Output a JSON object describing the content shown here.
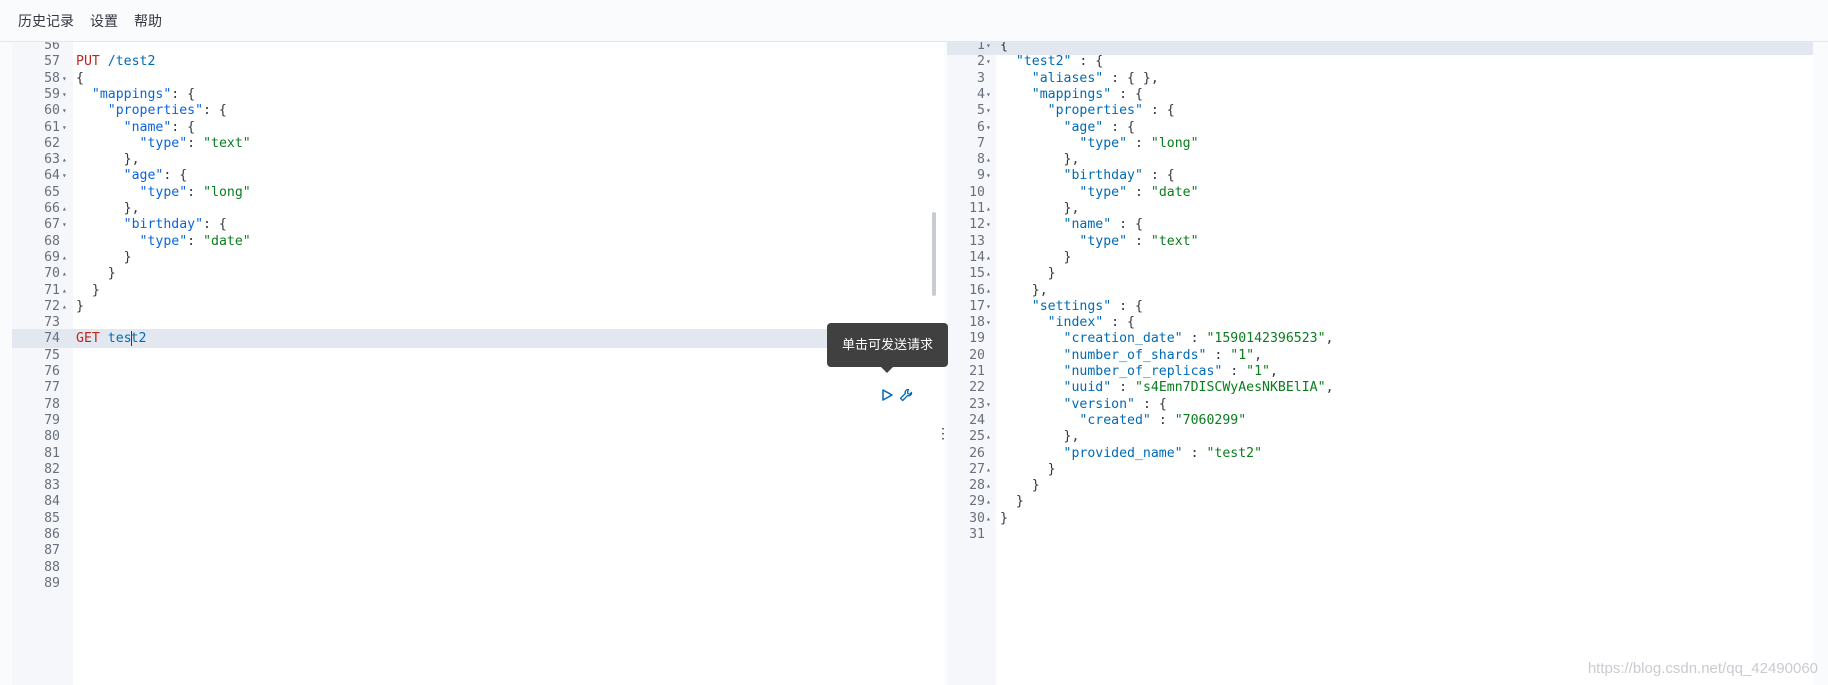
{
  "menu": [
    "历史记录",
    "设置",
    "帮助"
  ],
  "tooltip": "单击可发送请求",
  "watermark": "https://blog.csdn.net/qq_42490060",
  "left_editor": {
    "lines": [
      {
        "n": "56",
        "fold": "",
        "tokens": []
      },
      {
        "n": "57",
        "fold": "",
        "tokens": [
          [
            "PUT",
            "method"
          ],
          [
            " /test2",
            "url"
          ]
        ]
      },
      {
        "n": "58",
        "fold": "▾",
        "tokens": [
          [
            "{",
            "punc"
          ]
        ]
      },
      {
        "n": "59",
        "fold": "▾",
        "tokens": [
          [
            "  ",
            "punc"
          ],
          [
            "\"mappings\"",
            "key"
          ],
          [
            ": {",
            "punc"
          ]
        ]
      },
      {
        "n": "60",
        "fold": "▾",
        "tokens": [
          [
            "    ",
            "punc"
          ],
          [
            "\"properties\"",
            "key"
          ],
          [
            ": {",
            "punc"
          ]
        ]
      },
      {
        "n": "61",
        "fold": "▾",
        "tokens": [
          [
            "      ",
            "punc"
          ],
          [
            "\"name\"",
            "key"
          ],
          [
            ": {",
            "punc"
          ]
        ]
      },
      {
        "n": "62",
        "fold": "",
        "tokens": [
          [
            "        ",
            "punc"
          ],
          [
            "\"type\"",
            "key"
          ],
          [
            ": ",
            "punc"
          ],
          [
            "\"text\"",
            "str"
          ]
        ]
      },
      {
        "n": "63",
        "fold": "▴",
        "tokens": [
          [
            "      },",
            "punc"
          ]
        ]
      },
      {
        "n": "64",
        "fold": "▾",
        "tokens": [
          [
            "      ",
            "punc"
          ],
          [
            "\"age\"",
            "key"
          ],
          [
            ": {",
            "punc"
          ]
        ]
      },
      {
        "n": "65",
        "fold": "",
        "tokens": [
          [
            "        ",
            "punc"
          ],
          [
            "\"type\"",
            "key"
          ],
          [
            ": ",
            "punc"
          ],
          [
            "\"long\"",
            "str"
          ]
        ]
      },
      {
        "n": "66",
        "fold": "▴",
        "tokens": [
          [
            "      },",
            "punc"
          ]
        ]
      },
      {
        "n": "67",
        "fold": "▾",
        "tokens": [
          [
            "      ",
            "punc"
          ],
          [
            "\"birthday\"",
            "key"
          ],
          [
            ": {",
            "punc"
          ]
        ]
      },
      {
        "n": "68",
        "fold": "",
        "tokens": [
          [
            "        ",
            "punc"
          ],
          [
            "\"type\"",
            "key"
          ],
          [
            ": ",
            "punc"
          ],
          [
            "\"date\"",
            "str"
          ]
        ]
      },
      {
        "n": "69",
        "fold": "▴",
        "tokens": [
          [
            "      }",
            "punc"
          ]
        ]
      },
      {
        "n": "70",
        "fold": "▴",
        "tokens": [
          [
            "    }",
            "punc"
          ]
        ]
      },
      {
        "n": "71",
        "fold": "▴",
        "tokens": [
          [
            "  }",
            "punc"
          ]
        ]
      },
      {
        "n": "72",
        "fold": "▴",
        "tokens": [
          [
            "}",
            "punc"
          ]
        ]
      },
      {
        "n": "73",
        "fold": "",
        "tokens": []
      },
      {
        "n": "74",
        "fold": "",
        "active": true,
        "tokens": [
          [
            "GET",
            "method"
          ],
          [
            " tes",
            "url"
          ],
          [
            "|CURSOR|",
            "cursor"
          ],
          [
            "t2",
            "url"
          ]
        ]
      },
      {
        "n": "75",
        "fold": "",
        "tokens": []
      },
      {
        "n": "76",
        "fold": "",
        "tokens": []
      },
      {
        "n": "77",
        "fold": "",
        "tokens": []
      },
      {
        "n": "78",
        "fold": "",
        "tokens": []
      },
      {
        "n": "79",
        "fold": "",
        "tokens": []
      },
      {
        "n": "80",
        "fold": "",
        "tokens": []
      },
      {
        "n": "81",
        "fold": "",
        "tokens": []
      },
      {
        "n": "82",
        "fold": "",
        "tokens": []
      },
      {
        "n": "83",
        "fold": "",
        "tokens": []
      },
      {
        "n": "84",
        "fold": "",
        "tokens": []
      },
      {
        "n": "85",
        "fold": "",
        "tokens": []
      },
      {
        "n": "86",
        "fold": "",
        "tokens": []
      },
      {
        "n": "87",
        "fold": "",
        "tokens": []
      },
      {
        "n": "88",
        "fold": "",
        "tokens": []
      },
      {
        "n": "89",
        "fold": "",
        "tokens": []
      }
    ]
  },
  "right_editor": {
    "lines": [
      {
        "n": "1",
        "fold": "▾",
        "active": true,
        "tokens": [
          [
            "{",
            "punc"
          ]
        ]
      },
      {
        "n": "2",
        "fold": "▾",
        "tokens": [
          [
            "  ",
            "punc"
          ],
          [
            "\"test2\"",
            "key"
          ],
          [
            " : {",
            "punc"
          ]
        ]
      },
      {
        "n": "3",
        "fold": "",
        "tokens": [
          [
            "    ",
            "punc"
          ],
          [
            "\"aliases\"",
            "key"
          ],
          [
            " : { },",
            "punc"
          ]
        ]
      },
      {
        "n": "4",
        "fold": "▾",
        "tokens": [
          [
            "    ",
            "punc"
          ],
          [
            "\"mappings\"",
            "key"
          ],
          [
            " : {",
            "punc"
          ]
        ]
      },
      {
        "n": "5",
        "fold": "▾",
        "tokens": [
          [
            "      ",
            "punc"
          ],
          [
            "\"properties\"",
            "key"
          ],
          [
            " : {",
            "punc"
          ]
        ]
      },
      {
        "n": "6",
        "fold": "▾",
        "tokens": [
          [
            "        ",
            "punc"
          ],
          [
            "\"age\"",
            "key"
          ],
          [
            " : {",
            "punc"
          ]
        ]
      },
      {
        "n": "7",
        "fold": "",
        "tokens": [
          [
            "          ",
            "punc"
          ],
          [
            "\"type\"",
            "key"
          ],
          [
            " : ",
            "punc"
          ],
          [
            "\"long\"",
            "str"
          ]
        ]
      },
      {
        "n": "8",
        "fold": "▴",
        "tokens": [
          [
            "        },",
            "punc"
          ]
        ]
      },
      {
        "n": "9",
        "fold": "▾",
        "tokens": [
          [
            "        ",
            "punc"
          ],
          [
            "\"birthday\"",
            "key"
          ],
          [
            " : {",
            "punc"
          ]
        ]
      },
      {
        "n": "10",
        "fold": "",
        "tokens": [
          [
            "          ",
            "punc"
          ],
          [
            "\"type\"",
            "key"
          ],
          [
            " : ",
            "punc"
          ],
          [
            "\"date\"",
            "str"
          ]
        ]
      },
      {
        "n": "11",
        "fold": "▴",
        "tokens": [
          [
            "        },",
            "punc"
          ]
        ]
      },
      {
        "n": "12",
        "fold": "▾",
        "tokens": [
          [
            "        ",
            "punc"
          ],
          [
            "\"name\"",
            "key"
          ],
          [
            " : {",
            "punc"
          ]
        ]
      },
      {
        "n": "13",
        "fold": "",
        "tokens": [
          [
            "          ",
            "punc"
          ],
          [
            "\"type\"",
            "key"
          ],
          [
            " : ",
            "punc"
          ],
          [
            "\"text\"",
            "str"
          ]
        ]
      },
      {
        "n": "14",
        "fold": "▴",
        "tokens": [
          [
            "        }",
            "punc"
          ]
        ]
      },
      {
        "n": "15",
        "fold": "▴",
        "tokens": [
          [
            "      }",
            "punc"
          ]
        ]
      },
      {
        "n": "16",
        "fold": "▴",
        "tokens": [
          [
            "    },",
            "punc"
          ]
        ]
      },
      {
        "n": "17",
        "fold": "▾",
        "tokens": [
          [
            "    ",
            "punc"
          ],
          [
            "\"settings\"",
            "key"
          ],
          [
            " : {",
            "punc"
          ]
        ]
      },
      {
        "n": "18",
        "fold": "▾",
        "tokens": [
          [
            "      ",
            "punc"
          ],
          [
            "\"index\"",
            "key"
          ],
          [
            " : {",
            "punc"
          ]
        ]
      },
      {
        "n": "19",
        "fold": "",
        "tokens": [
          [
            "        ",
            "punc"
          ],
          [
            "\"creation_date\"",
            "key"
          ],
          [
            " : ",
            "punc"
          ],
          [
            "\"1590142396523\"",
            "str"
          ],
          [
            ",",
            "punc"
          ]
        ]
      },
      {
        "n": "20",
        "fold": "",
        "tokens": [
          [
            "        ",
            "punc"
          ],
          [
            "\"number_of_shards\"",
            "key"
          ],
          [
            " : ",
            "punc"
          ],
          [
            "\"1\"",
            "str"
          ],
          [
            ",",
            "punc"
          ]
        ]
      },
      {
        "n": "21",
        "fold": "",
        "tokens": [
          [
            "        ",
            "punc"
          ],
          [
            "\"number_of_replicas\"",
            "key"
          ],
          [
            " : ",
            "punc"
          ],
          [
            "\"1\"",
            "str"
          ],
          [
            ",",
            "punc"
          ]
        ]
      },
      {
        "n": "22",
        "fold": "",
        "tokens": [
          [
            "        ",
            "punc"
          ],
          [
            "\"uuid\"",
            "key"
          ],
          [
            " : ",
            "punc"
          ],
          [
            "\"s4Emn7DISCWyAesNKBElIA\"",
            "str"
          ],
          [
            ",",
            "punc"
          ]
        ]
      },
      {
        "n": "23",
        "fold": "▾",
        "tokens": [
          [
            "        ",
            "punc"
          ],
          [
            "\"version\"",
            "key"
          ],
          [
            " : {",
            "punc"
          ]
        ]
      },
      {
        "n": "24",
        "fold": "",
        "tokens": [
          [
            "          ",
            "punc"
          ],
          [
            "\"created\"",
            "key"
          ],
          [
            " : ",
            "punc"
          ],
          [
            "\"7060299\"",
            "str"
          ]
        ]
      },
      {
        "n": "25",
        "fold": "▴",
        "tokens": [
          [
            "        },",
            "punc"
          ]
        ]
      },
      {
        "n": "26",
        "fold": "",
        "tokens": [
          [
            "        ",
            "punc"
          ],
          [
            "\"provided_name\"",
            "key"
          ],
          [
            " : ",
            "punc"
          ],
          [
            "\"test2\"",
            "str"
          ]
        ]
      },
      {
        "n": "27",
        "fold": "▴",
        "tokens": [
          [
            "      }",
            "punc"
          ]
        ]
      },
      {
        "n": "28",
        "fold": "▴",
        "tokens": [
          [
            "    }",
            "punc"
          ]
        ]
      },
      {
        "n": "29",
        "fold": "▴",
        "tokens": [
          [
            "  }",
            "punc"
          ]
        ]
      },
      {
        "n": "30",
        "fold": "▴",
        "tokens": [
          [
            "}",
            "punc"
          ]
        ]
      },
      {
        "n": "31",
        "fold": "",
        "tokens": []
      }
    ]
  },
  "icons": {
    "run": "play-icon",
    "wrench": "wrench-icon",
    "resize": "vertical-dots-icon"
  },
  "colors": {
    "method": "#bd271e",
    "url": "#006bb4",
    "key": "#006bb4",
    "string": "#0a7d1e",
    "active_line": "#e3e8f0"
  }
}
